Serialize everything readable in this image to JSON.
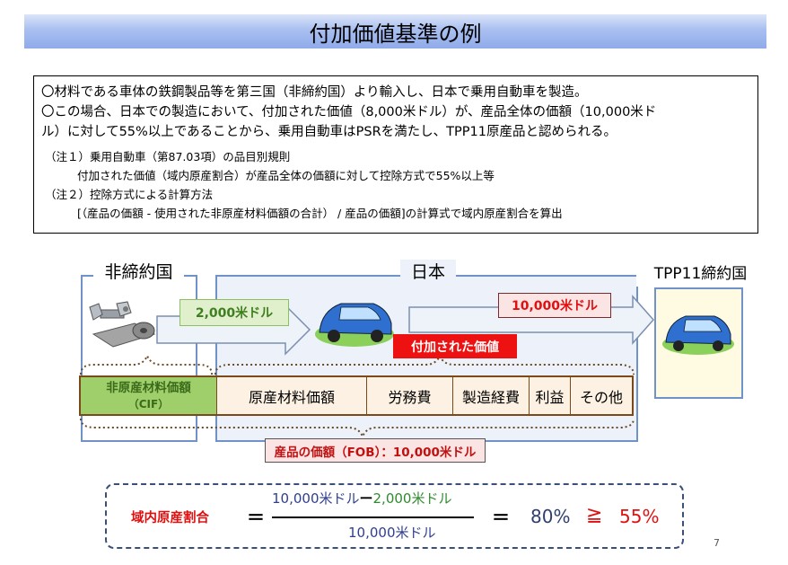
{
  "title": "付加価値基準の例",
  "description": {
    "line1": "〇材料である車体の鉄鋼製品等を第三国（非締約国）より輸入し、日本で乗用自動車を製造。",
    "line2": "〇この場合、日本での製造において、付加された価値（8,000米ドル）が、産品全体の価額（10,000米ド",
    "line3": "ル）に対して55%以上であることから、乗用自動車はPSRを満たし、TPP11原産品と認められる。",
    "note1": "（注１）乗用自動車（第87.03項）の品目別規則",
    "note1_detail": "付加された価値（域内原産割合）が産品全体の価額に対して控除方式で55%以上等",
    "note2": "（注２）控除方式による計算方法",
    "note2_detail": "[（産品の価額 - 使用された非原産材料価額の合計） / 産品の価額]の計算式で域内原産割合を算出"
  },
  "regions": {
    "left": "非締約国",
    "middle": "日本",
    "right": "TPP11締約国"
  },
  "arrows": {
    "import_value": "2,000米ドル",
    "export_value": "10,000米ドル",
    "added_value_label": "付加された価値"
  },
  "cost_breakdown": {
    "non_originating": "非原産材料価額",
    "non_originating_sub": "（CIF）",
    "items": [
      "原産材料価額",
      "労務費",
      "製造経費",
      "利益",
      "その他"
    ]
  },
  "fob_label": "産品の価額（FOB）：10,000米ドル",
  "formula": {
    "label": "域内原産割合",
    "equals": "＝",
    "numerator_a": "10,000米ドル",
    "minus": "ー",
    "numerator_b": "2,000米ドル",
    "denominator": "10,000米ドル",
    "result": "80%",
    "ge": "≧",
    "threshold": "55%"
  },
  "page_number": "7",
  "colors": {
    "title_gradient": "#8fabea",
    "panel_border": "#6f93c8",
    "accent_red": "#e01010",
    "accent_green": "#3f7f1f",
    "car_blue": "#2f6fd0"
  }
}
